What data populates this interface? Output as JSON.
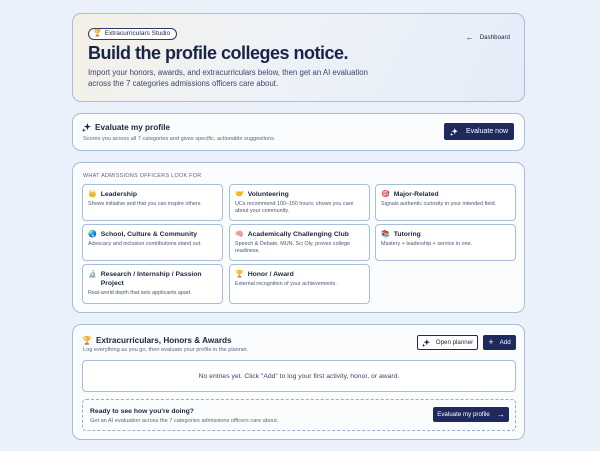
{
  "hero": {
    "badge": "Extracurriculars Studio",
    "title": "Build the profile colleges notice.",
    "subtitle": "Import your honors, awards, and extracurriculars below, then get an AI evaluation across the 7 categories admissions officers care about.",
    "dashboard_label": "Dashboard"
  },
  "evaluate": {
    "title": "Evaluate my profile",
    "subtitle": "Scores you across all 7 categories and gives specific, actionable suggestions.",
    "button_label": "Evaluate now"
  },
  "categories": {
    "heading": "WHAT ADMISSIONS OFFICERS LOOK FOR",
    "items": [
      {
        "icon": "👑",
        "title": "Leadership",
        "desc": "Shows initiative and that you can inspire others."
      },
      {
        "icon": "🤝",
        "title": "Volunteering",
        "desc": "UCs recommend 100–150 hours; shows you care about your community."
      },
      {
        "icon": "🎯",
        "title": "Major-Related",
        "desc": "Signals authentic curiosity in your intended field."
      },
      {
        "icon": "🌏",
        "title": "School, Culture & Community",
        "desc": "Advocacy and inclusion contributions stand out."
      },
      {
        "icon": "🧠",
        "title": "Academically Challenging Club",
        "desc": "Speech & Debate, MUN, Sci Oly, proves college readiness."
      },
      {
        "icon": "📚",
        "title": "Tutoring",
        "desc": "Mastery + leadership + service in one."
      },
      {
        "icon": "🔬",
        "title": "Research / Internship / Passion Project",
        "desc": "Real-world depth that sets applicants apart."
      },
      {
        "icon": "🏆",
        "title": "Honor / Award",
        "desc": "External recognition of your achievements."
      }
    ]
  },
  "ec": {
    "title": "Extracurriculars, Honors & Awards",
    "subtitle": "Log everything as you go, then evaluate your profile in the planner.",
    "planner_label": "Open planner",
    "add_label": "Add",
    "empty_text": "No entries yet. Click \"Add\" to log your first activity, honor, or award.",
    "ready_title": "Ready to see how you're doing?",
    "ready_subtitle": "Get an AI evaluation across the 7 categories admissions officers care about.",
    "ready_button": "Evaluate my profile"
  }
}
